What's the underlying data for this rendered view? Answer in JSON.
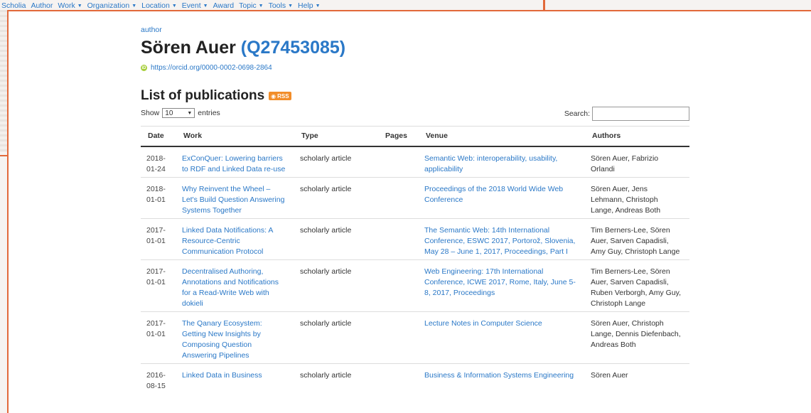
{
  "navbar": {
    "items": [
      {
        "label": "Scholia",
        "dropdown": false
      },
      {
        "label": "Author",
        "dropdown": false
      },
      {
        "label": "Work",
        "dropdown": true
      },
      {
        "label": "Organization",
        "dropdown": true
      },
      {
        "label": "Location",
        "dropdown": true
      },
      {
        "label": "Event",
        "dropdown": true
      },
      {
        "label": "Award",
        "dropdown": false
      },
      {
        "label": "Topic",
        "dropdown": true
      },
      {
        "label": "Tools",
        "dropdown": true
      },
      {
        "label": "Help",
        "dropdown": true
      }
    ]
  },
  "entity": {
    "type_label": "author",
    "name": "Sören Auer",
    "qid": "Q27453085",
    "orcid_url": "https://orcid.org/0000-0002-0698-2864"
  },
  "publications": {
    "heading": "List of publications",
    "rss_label": "RSS",
    "length_prefix": "Show",
    "length_value": "10",
    "length_suffix": "entries",
    "search_label": "Search:",
    "search_value": "",
    "columns": [
      "Date",
      "Work",
      "Type",
      "Pages",
      "Venue",
      "Authors"
    ],
    "rows": [
      {
        "date": "2018-01-24",
        "work": "ExConQuer: Lowering barriers to RDF and Linked Data re-use",
        "type": "scholarly article",
        "pages": "",
        "venue": "Semantic Web: interoperability, usability, applicability",
        "authors": "Sören Auer, Fabrizio Orlandi"
      },
      {
        "date": "2018-01-01",
        "work": "Why Reinvent the Wheel – Let's Build Question Answering Systems Together",
        "type": "scholarly article",
        "pages": "",
        "venue": "Proceedings of the 2018 World Wide Web Conference",
        "authors": "Sören Auer, Jens Lehmann, Christoph Lange, Andreas Both"
      },
      {
        "date": "2017-01-01",
        "work": "Linked Data Notifications: A Resource-Centric Communication Protocol",
        "type": "scholarly article",
        "pages": "",
        "venue": "The Semantic Web: 14th International Conference, ESWC 2017, Portorož, Slovenia, May 28 – June 1, 2017, Proceedings, Part I",
        "authors": "Tim Berners-Lee, Sören Auer, Sarven Capadisli, Amy Guy, Christoph Lange"
      },
      {
        "date": "2017-01-01",
        "work": "Decentralised Authoring, Annotations and Notifications for a Read-Write Web with dokieli",
        "type": "scholarly article",
        "pages": "",
        "venue": "Web Engineering: 17th International Conference, ICWE 2017, Rome, Italy, June 5-8, 2017, Proceedings",
        "authors": "Tim Berners-Lee, Sören Auer, Sarven Capadisli, Ruben Verborgh, Amy Guy, Christoph Lange"
      },
      {
        "date": "2017-01-01",
        "work": "The Qanary Ecosystem: Getting New Insights by Composing Question Answering Pipelines",
        "type": "scholarly article",
        "pages": "",
        "venue": "Lecture Notes in Computer Science",
        "authors": "Sören Auer, Christoph Lange, Dennis Diefenbach, Andreas Both"
      },
      {
        "date": "2016-08-15",
        "work": "Linked Data in Business",
        "type": "scholarly article",
        "pages": "",
        "venue": "Business & Information Systems Engineering",
        "authors": "Sören Auer"
      }
    ]
  },
  "colors": {
    "link": "#2a78c7",
    "window_border": "#e2693a",
    "orcid": "#a6ce39",
    "rss": "#f28d29"
  },
  "icons": [
    "caret-down-icon",
    "orcid-icon",
    "rss-icon"
  ]
}
